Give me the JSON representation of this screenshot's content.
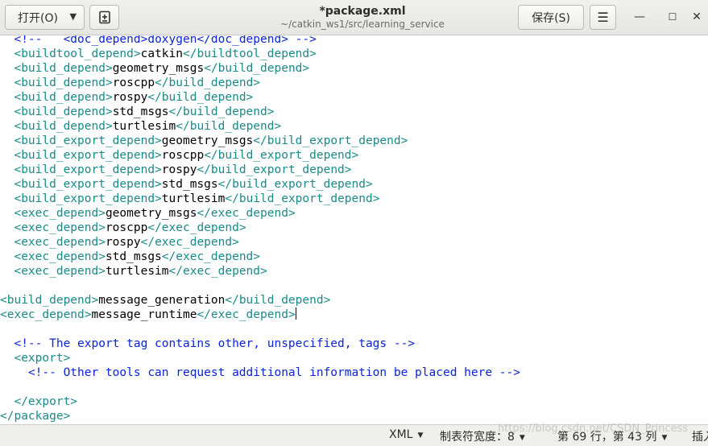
{
  "header": {
    "open_label": "打开(O)",
    "save_label": "保存(S)",
    "title": "*package.xml",
    "subtitle": "~/catkin_ws1/src/learning_service"
  },
  "editor": {
    "lines": [
      {
        "parts": [
          [
            "c",
            "  <!--   "
          ],
          [
            "c",
            "<doc_depend>doxygen</doc_depend> -->"
          ]
        ]
      },
      {
        "parts": [
          [
            "t",
            "  <buildtool_depend>"
          ],
          [
            "x",
            "catkin"
          ],
          [
            "t",
            "</buildtool_depend>"
          ]
        ]
      },
      {
        "parts": [
          [
            "t",
            "  <build_depend>"
          ],
          [
            "x",
            "geometry_msgs"
          ],
          [
            "t",
            "</build_depend>"
          ]
        ]
      },
      {
        "parts": [
          [
            "t",
            "  <build_depend>"
          ],
          [
            "x",
            "roscpp"
          ],
          [
            "t",
            "</build_depend>"
          ]
        ]
      },
      {
        "parts": [
          [
            "t",
            "  <build_depend>"
          ],
          [
            "x",
            "rospy"
          ],
          [
            "t",
            "</build_depend>"
          ]
        ]
      },
      {
        "parts": [
          [
            "t",
            "  <build_depend>"
          ],
          [
            "x",
            "std_msgs"
          ],
          [
            "t",
            "</build_depend>"
          ]
        ]
      },
      {
        "parts": [
          [
            "t",
            "  <build_depend>"
          ],
          [
            "x",
            "turtlesim"
          ],
          [
            "t",
            "</build_depend>"
          ]
        ]
      },
      {
        "parts": [
          [
            "t",
            "  <build_export_depend>"
          ],
          [
            "x",
            "geometry_msgs"
          ],
          [
            "t",
            "</build_export_depend>"
          ]
        ]
      },
      {
        "parts": [
          [
            "t",
            "  <build_export_depend>"
          ],
          [
            "x",
            "roscpp"
          ],
          [
            "t",
            "</build_export_depend>"
          ]
        ]
      },
      {
        "parts": [
          [
            "t",
            "  <build_export_depend>"
          ],
          [
            "x",
            "rospy"
          ],
          [
            "t",
            "</build_export_depend>"
          ]
        ]
      },
      {
        "parts": [
          [
            "t",
            "  <build_export_depend>"
          ],
          [
            "x",
            "std_msgs"
          ],
          [
            "t",
            "</build_export_depend>"
          ]
        ]
      },
      {
        "parts": [
          [
            "t",
            "  <build_export_depend>"
          ],
          [
            "x",
            "turtlesim"
          ],
          [
            "t",
            "</build_export_depend>"
          ]
        ]
      },
      {
        "parts": [
          [
            "t",
            "  <exec_depend>"
          ],
          [
            "x",
            "geometry_msgs"
          ],
          [
            "t",
            "</exec_depend>"
          ]
        ]
      },
      {
        "parts": [
          [
            "t",
            "  <exec_depend>"
          ],
          [
            "x",
            "roscpp"
          ],
          [
            "t",
            "</exec_depend>"
          ]
        ]
      },
      {
        "parts": [
          [
            "t",
            "  <exec_depend>"
          ],
          [
            "x",
            "rospy"
          ],
          [
            "t",
            "</exec_depend>"
          ]
        ]
      },
      {
        "parts": [
          [
            "t",
            "  <exec_depend>"
          ],
          [
            "x",
            "std_msgs"
          ],
          [
            "t",
            "</exec_depend>"
          ]
        ]
      },
      {
        "parts": [
          [
            "t",
            "  <exec_depend>"
          ],
          [
            "x",
            "turtlesim"
          ],
          [
            "t",
            "</exec_depend>"
          ]
        ]
      },
      {
        "parts": []
      },
      {
        "parts": [
          [
            "t",
            "<build_depend>"
          ],
          [
            "x",
            "message_generation"
          ],
          [
            "t",
            "</build_depend>"
          ]
        ]
      },
      {
        "parts": [
          [
            "t",
            "<exec_depend>"
          ],
          [
            "x",
            "message_runtime"
          ],
          [
            "t",
            "</exec_depend>"
          ]
        ],
        "cursor": true
      },
      {
        "parts": []
      },
      {
        "parts": [
          [
            "c",
            "  <!-- The export tag contains other, unspecified, tags -->"
          ]
        ]
      },
      {
        "parts": [
          [
            "t",
            "  <export>"
          ]
        ]
      },
      {
        "parts": [
          [
            "c",
            "    <!-- Other tools can request additional information be placed here -->"
          ]
        ]
      },
      {
        "parts": []
      },
      {
        "parts": [
          [
            "t",
            "  </export>"
          ]
        ]
      },
      {
        "parts": [
          [
            "t",
            "</package>"
          ]
        ]
      }
    ]
  },
  "status": {
    "language": "XML",
    "tab_width": "制表符宽度：8",
    "position": "第 69 行，第 43 列",
    "mode": "插入"
  },
  "watermark": "https://blog.csdn.net/CSDN_Princess"
}
